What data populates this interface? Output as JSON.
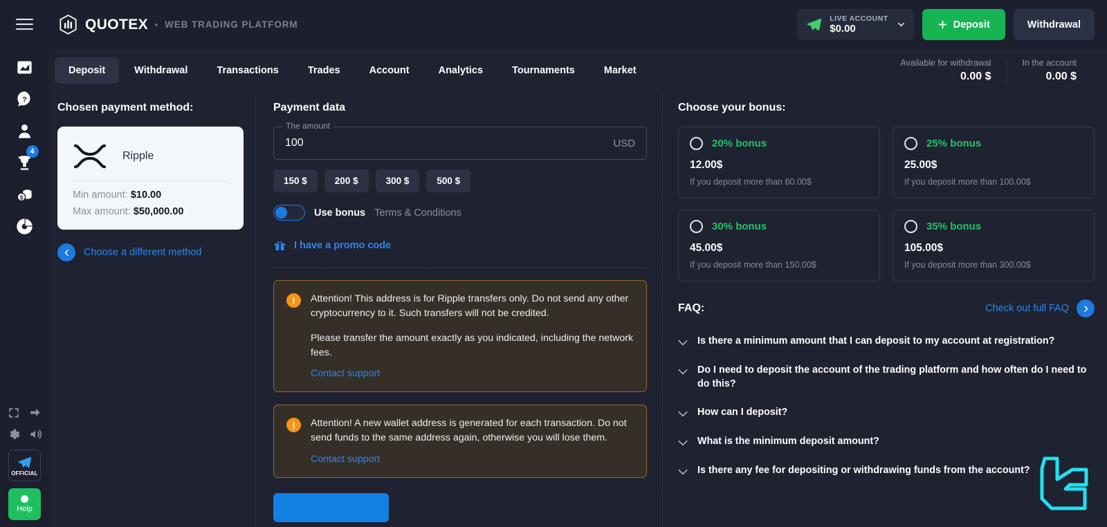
{
  "sidebar": {
    "menu_icon": "hamburger-menu-icon",
    "items": [
      {
        "name": "chart-icon",
        "badge": null
      },
      {
        "name": "help-icon",
        "badge": null
      },
      {
        "name": "profile-icon",
        "badge": null
      },
      {
        "name": "trophy-icon",
        "badge": "4"
      },
      {
        "name": "coins-icon",
        "badge": null
      },
      {
        "name": "pie-chart-icon",
        "badge": null
      }
    ],
    "bottom": {
      "fullscreen_icon": "fullscreen-icon",
      "arrow_icon": "arrow-right-icon",
      "settings_icon": "gear-icon",
      "sound_icon": "sound-icon",
      "telegram_label": "OFFICIAL",
      "help_label": "Help"
    }
  },
  "header": {
    "brand": "QUOTEX",
    "subtitle": "WEB TRADING PLATFORM",
    "account": {
      "label": "LIVE ACCOUNT",
      "amount": "$0.00"
    },
    "deposit_button": "Deposit",
    "withdrawal_button": "Withdrawal"
  },
  "tabs": [
    {
      "label": "Deposit",
      "active": true
    },
    {
      "label": "Withdrawal",
      "active": false
    },
    {
      "label": "Transactions",
      "active": false
    },
    {
      "label": "Trades",
      "active": false
    },
    {
      "label": "Account",
      "active": false
    },
    {
      "label": "Analytics",
      "active": false
    },
    {
      "label": "Tournaments",
      "active": false
    },
    {
      "label": "Market",
      "active": false
    }
  ],
  "balances": [
    {
      "label": "Available for withdrawal",
      "value": "0.00 $"
    },
    {
      "label": "In the account",
      "value": "0.00 $"
    }
  ],
  "payment_method": {
    "title": "Chosen payment method:",
    "name": "Ripple",
    "icon": "ripple-xrp-icon",
    "min_label": "Min amount:",
    "min_value": "$10.00",
    "max_label": "Max amount:",
    "max_value": "$50,000.00",
    "change_link": "Choose a different method"
  },
  "payment_data": {
    "title": "Payment data",
    "amount_legend": "The amount",
    "amount_value": "100",
    "amount_placeholder": "0",
    "currency": "USD",
    "quick_amounts": [
      "150 $",
      "200 $",
      "300 $",
      "500 $"
    ],
    "use_bonus_label": "Use bonus",
    "terms_label": "Terms & Conditions",
    "use_bonus_on": true,
    "promo_label": "I have a promo code",
    "promo_icon": "gift-icon",
    "alerts": [
      {
        "icon": "warning-icon",
        "paragraphs": [
          "Attention! This address is for Ripple transfers only. Do not send any other cryptocurrency to it. Such transfers will not be credited.",
          "Please transfer the amount exactly as you indicated, including the network fees."
        ],
        "link": "Contact support"
      },
      {
        "icon": "warning-icon",
        "paragraphs": [
          "Attention! A new wallet address is generated for each transaction. Do not send funds to the same address again, otherwise you will lose them."
        ],
        "link": "Contact support"
      }
    ],
    "pay_button": ""
  },
  "bonus": {
    "title": "Choose your bonus:",
    "options": [
      {
        "percent": "20% bonus",
        "amount": "12.00$",
        "condition": "If you deposit more than 60.00$",
        "selected": false
      },
      {
        "percent": "25% bonus",
        "amount": "25.00$",
        "condition": "If you deposit more than 100.00$",
        "selected": false
      },
      {
        "percent": "30% bonus",
        "amount": "45.00$",
        "condition": "If you deposit more than 150.00$",
        "selected": false
      },
      {
        "percent": "35% bonus",
        "amount": "105.00$",
        "condition": "If you deposit more than 300.00$",
        "selected": false
      }
    ]
  },
  "faq": {
    "title": "FAQ:",
    "link": "Check out full FAQ",
    "items": [
      "Is there a minimum amount that I can deposit to my account at registration?",
      "Do I need to deposit the account of the trading platform and how often do I need to do this?",
      "How can I deposit?",
      "What is the minimum deposit amount?",
      "Is there any fee for depositing or withdrawing funds from the account?"
    ]
  },
  "colors": {
    "background": "#1e2231",
    "panel": "#1b1f2e",
    "accent_blue": "#2e86e8",
    "accent_green": "#16b453",
    "bonus_green": "#23c268",
    "warning_orange": "#f59518",
    "watermark_cyan": "#22e0ee"
  }
}
